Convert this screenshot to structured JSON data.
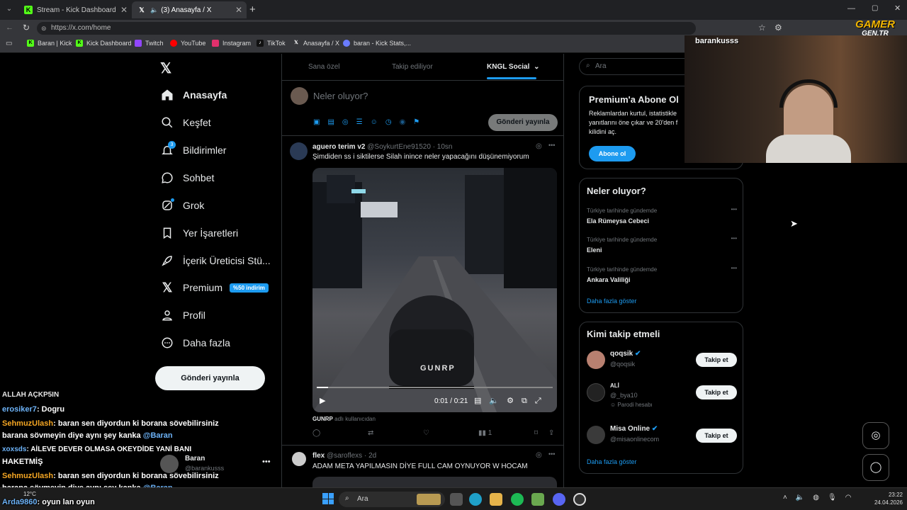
{
  "browser": {
    "tabs": [
      {
        "title": "Stream - Kick Dashboard",
        "active": false
      },
      {
        "title": "(3) Anasayfa / X",
        "active": true
      }
    ],
    "url": "https://x.com/home",
    "bookmarks": [
      "Baran | Kick",
      "Kick Dashboard",
      "Twitch",
      "YouTube",
      "Instagram",
      "TikTok",
      "Anasayfa / X",
      "baran - Kick Stats,..."
    ]
  },
  "sidebar": {
    "items": [
      {
        "label": "Anasayfa",
        "icon": "home-icon"
      },
      {
        "label": "Keşfet",
        "icon": "search-icon"
      },
      {
        "label": "Bildirimler",
        "icon": "bell-icon",
        "badge": "3"
      },
      {
        "label": "Sohbet",
        "icon": "chat-icon"
      },
      {
        "label": "Grok",
        "icon": "grok-icon"
      },
      {
        "label": "Yer İşaretleri",
        "icon": "bookmark-icon"
      },
      {
        "label": "İçerik Üreticisi Stü...",
        "icon": "rocket-icon"
      },
      {
        "label": "Premium",
        "icon": "x-icon",
        "badge": "%50 indirim"
      },
      {
        "label": "Profil",
        "icon": "person-icon"
      },
      {
        "label": "Daha fazla",
        "icon": "more-icon"
      }
    ],
    "post_button": "Gönderi yayınla",
    "account": {
      "name": "Baran",
      "handle": "@barankusss"
    }
  },
  "feed": {
    "tabs": [
      "Sana özel",
      "Takip ediliyor",
      "KNGL Social"
    ],
    "compose_placeholder": "Neler oluyor?",
    "compose_button": "Gönderi yayınla",
    "posts": [
      {
        "author": "aguero terim v2",
        "handle": "@SoykurtEne91520",
        "time": "· 10sn",
        "text": "Şimdiden ss i siktilerse Silah inince neler yapacağını düşünemiyorum",
        "video_overlay": "GUNRP",
        "video_time": "0:01 / 0:21",
        "source": "GUNRP",
        "source_suffix": "adlı kullanıcıdan",
        "views": "1"
      },
      {
        "author": "flex",
        "handle": "@saroflexs",
        "time": "· 2d",
        "text": "ADAM META YAPILMASIN DİYE FULL CAM OYNUYOR  W HOCAM"
      }
    ]
  },
  "right": {
    "search_placeholder": "Ara",
    "premium": {
      "title": "Premium'a Abone Ol",
      "line1": "Reklamlardan kurtul, istatistikle",
      "line2": "yanıtlarını öne çıkar ve 20'den f",
      "line3": "kilidini aç.",
      "button": "Abone ol"
    },
    "trends_title": "Neler oluyor?",
    "trends": [
      {
        "category": "Türkiye tarihinde gündemde",
        "name": "Ela Rümeysa Cebeci"
      },
      {
        "category": "Türkiye tarihinde gündemde",
        "name": "Eleni"
      },
      {
        "category": "Türkiye tarihinde gündemde",
        "name": "Ankara Valiliği"
      }
    ],
    "show_more": "Daha fazla göster",
    "who_title": "Kimi takip etmeli",
    "who": [
      {
        "name": "qoqsik",
        "handle": "@qoqsik",
        "verified": true,
        "extra": ""
      },
      {
        "name": "ALİ",
        "handle": "@_bya10",
        "verified": false,
        "extra": "Parodi hesabı"
      },
      {
        "name": "Misa Online",
        "handle": "@misaonlinecom",
        "verified": true,
        "extra": ""
      }
    ],
    "follow_label": "Takip et"
  },
  "stream_overlay": {
    "streamer": "barankusss",
    "logo_top": "GAMER",
    "logo_bottom": "GEN.TR",
    "chat": [
      {
        "user": "",
        "msg": "ALLAH AÇKP5IN"
      },
      {
        "user": "erosiker7",
        "msg": ": Dogru",
        "color": "#6db3f8"
      },
      {
        "user": "SehmuzUlash",
        "msg": ": baran sen diyordun ki borana sövebilirsiniz",
        "color": "#f5a623"
      },
      {
        "user": "",
        "msg": "barana sövmeyin diye aynı şey kanka ",
        "mention": "@Baran"
      },
      {
        "user": "xoxsds",
        "msg": ": AİLEVE DEVER OLMASA OKEYDİDE YANİ BANI",
        "color": "#6db3f8"
      },
      {
        "user": "",
        "msg": "HAKETMİŞ"
      },
      {
        "user": "SehmuzUlash",
        "msg": ": baran sen diyordun ki borana sövebilirsiniz",
        "color": "#f5a623"
      },
      {
        "user": "",
        "msg": "barana sövmeyin diye aynı şey kanka ",
        "mention": "@Baran"
      },
      {
        "user": "Arda9860",
        "msg": ": oyun lan oyun",
        "color": "#6db3f8"
      }
    ]
  },
  "taskbar": {
    "search": "Ara",
    "temp": "12°C",
    "time": "23:22",
    "date": "24.04.2026"
  }
}
